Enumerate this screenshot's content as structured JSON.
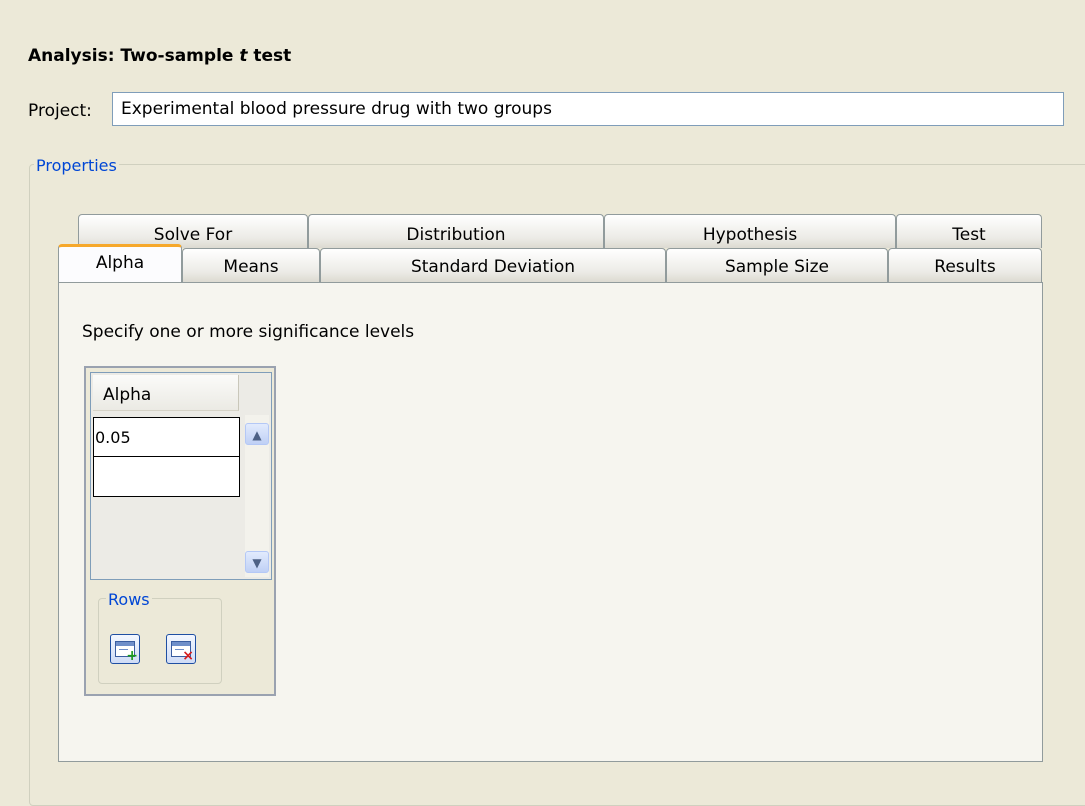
{
  "header": {
    "title_prefix": "Analysis: Two-sample ",
    "title_italic": "t",
    "title_suffix": " test"
  },
  "project": {
    "label": "Project:",
    "value": "Experimental blood pressure drug with two groups"
  },
  "properties": {
    "legend": "Properties"
  },
  "tabs": {
    "row1": [
      "Solve For",
      "Distribution",
      "Hypothesis",
      "Test"
    ],
    "row2": [
      "Alpha",
      "Means",
      "Standard Deviation",
      "Sample Size",
      "Results"
    ],
    "active": "Alpha"
  },
  "alpha_panel": {
    "instructions": "Specify one or more significance levels",
    "column_header": "Alpha",
    "rows": [
      "0.05",
      ""
    ],
    "rows_group_label": "Rows",
    "add_row_icon": "add-row-icon",
    "delete_row_icon": "delete-row-icon"
  },
  "colors": {
    "background": "#ece9d8",
    "legend_text": "#0046d5",
    "active_tab_accent": "#f6a82b"
  }
}
